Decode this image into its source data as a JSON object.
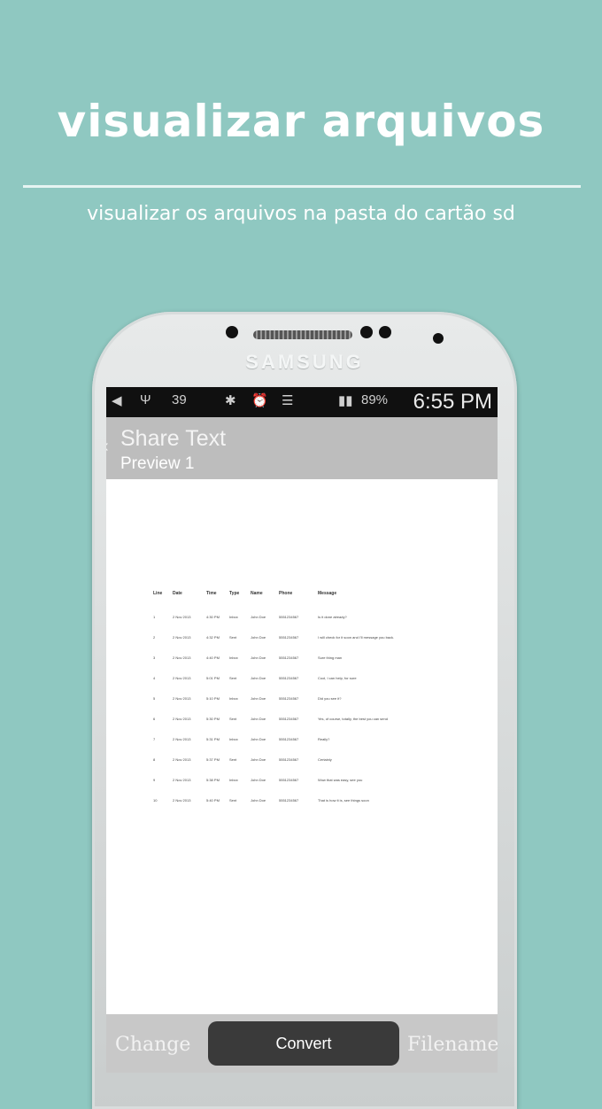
{
  "promo": {
    "title": "visualizar arquivos",
    "subtitle": "visualizar os arquivos na pasta do cartão sd"
  },
  "phone": {
    "brand": "SAMSUNG",
    "status": {
      "left_text": "39",
      "battery": "89%",
      "time": "6:55 PM"
    }
  },
  "app": {
    "title": "Share Text",
    "subtitle": "Preview  1"
  },
  "document": {
    "headers": [
      "Line",
      "Date",
      "Time",
      "Type",
      "Name",
      "Phone",
      "Message"
    ],
    "rows": [
      [
        "1",
        "2 Nov 2013",
        "4:30 PM",
        "Inbox",
        "John Doe",
        "5551234567",
        "Is it done already?"
      ],
      [
        "2",
        "2 Nov 2013",
        "4:32 PM",
        "Sent",
        "John Doe",
        "5551234567",
        "I will check for it soon and I'll message you back."
      ],
      [
        "3",
        "2 Nov 2013",
        "4:40 PM",
        "Inbox",
        "John Doe",
        "5551234567",
        "Sure thing man"
      ],
      [
        "4",
        "2 Nov 2013",
        "5:01 PM",
        "Sent",
        "John Doe",
        "5551234567",
        "Cool, I can help, for sure"
      ],
      [
        "5",
        "2 Nov 2013",
        "5:10 PM",
        "Inbox",
        "John Doe",
        "5551234567",
        "Did you see it?"
      ],
      [
        "6",
        "2 Nov 2013",
        "5:30 PM",
        "Sent",
        "John Doe",
        "5551234567",
        "Yes, of course, totally, the best you can send"
      ],
      [
        "7",
        "2 Nov 2013",
        "5:31 PM",
        "Inbox",
        "John Doe",
        "5551234567",
        "Really?"
      ],
      [
        "8",
        "2 Nov 2013",
        "5:37 PM",
        "Sent",
        "John Doe",
        "5551234567",
        "Certainly"
      ],
      [
        "9",
        "2 Nov 2013",
        "5:38 PM",
        "Inbox",
        "John Doe",
        "5551234567",
        "Wow that was easy, see you"
      ],
      [
        "10",
        "2 Nov 2013",
        "5:40 PM",
        "Sent",
        "John Doe",
        "5551234567",
        "That is how it is, see things soon"
      ]
    ]
  },
  "bottom": {
    "change": "Change",
    "convert": "Convert",
    "filename": "Filename"
  }
}
